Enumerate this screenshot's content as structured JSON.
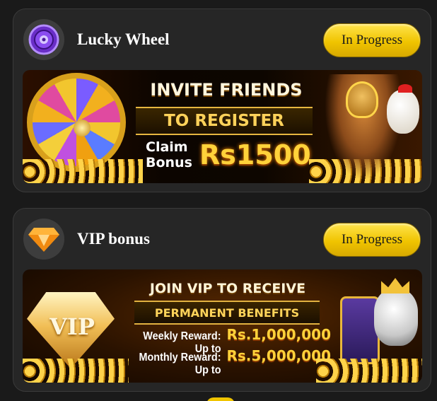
{
  "cards": [
    {
      "title": "Lucky Wheel",
      "status": "In Progress",
      "icon": "lucky-wheel-icon",
      "banner": {
        "headline": "INVITE FRIENDS",
        "subheadline": "TO REGISTER",
        "claim": "Claim Bonus",
        "amount": "Rs1500"
      }
    },
    {
      "title": "VIP bonus",
      "status": "In Progress",
      "icon": "vip-diamond-icon",
      "banner": {
        "badge": "VIP",
        "headline": "JOIN VIP TO RECEIVE",
        "subheadline": "PERMANENT BENEFITS",
        "rewards": [
          {
            "label": "Weekly Reward: Up to",
            "amount": "Rs.1,000,000"
          },
          {
            "label": "Monthly Reward: Up to",
            "amount": "Rs.5,000,000"
          }
        ]
      }
    }
  ],
  "colors": {
    "accent": "#f0c400",
    "card_background": "#262626",
    "page_background": "#1a1a1a"
  }
}
